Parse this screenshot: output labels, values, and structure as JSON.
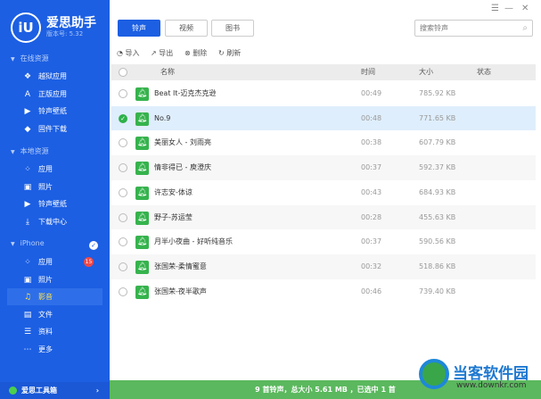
{
  "app": {
    "name": "爱思助手",
    "version": "版本号: 5.32",
    "logo_text": "iU"
  },
  "sidebar": {
    "sections": [
      {
        "label": "在线资源",
        "items": [
          {
            "label": "越狱应用",
            "icon": "jailbreak-icon"
          },
          {
            "label": "正版应用",
            "icon": "appstore-icon"
          },
          {
            "label": "铃声壁纸",
            "icon": "film-icon"
          },
          {
            "label": "固件下载",
            "icon": "box-icon"
          }
        ]
      },
      {
        "label": "本地资源",
        "items": [
          {
            "label": "应用",
            "icon": "apps-icon"
          },
          {
            "label": "照片",
            "icon": "photo-icon"
          },
          {
            "label": "铃声壁纸",
            "icon": "film-icon"
          },
          {
            "label": "下载中心",
            "icon": "download-icon"
          }
        ]
      },
      {
        "label": "iPhone",
        "items": [
          {
            "label": "应用",
            "icon": "apps-icon",
            "badge": "15"
          },
          {
            "label": "照片",
            "icon": "photo-icon"
          },
          {
            "label": "影音",
            "icon": "media-icon",
            "active": true
          },
          {
            "label": "文件",
            "icon": "file-icon"
          },
          {
            "label": "资料",
            "icon": "list-icon"
          },
          {
            "label": "更多",
            "icon": "more-icon"
          }
        ]
      }
    ],
    "toolbox": "爱思工具箱"
  },
  "tabs": [
    "铃声",
    "视频",
    "图书"
  ],
  "search": {
    "placeholder": "搜索铃声"
  },
  "toolbar": {
    "import": "导入",
    "export": "导出",
    "delete": "删除",
    "refresh": "刷新"
  },
  "table": {
    "headers": {
      "name": "名称",
      "time": "时间",
      "size": "大小",
      "status": "状态"
    },
    "rows": [
      {
        "name": "Beat It-迈克杰克逊",
        "time": "00:49",
        "size": "785.92 KB",
        "checked": false
      },
      {
        "name": "No.9",
        "time": "00:48",
        "size": "771.65 KB",
        "checked": true
      },
      {
        "name": "美丽女人 - 刘雨亮",
        "time": "00:38",
        "size": "607.79 KB",
        "checked": false
      },
      {
        "name": "情非得已 - 庾澄庆",
        "time": "00:37",
        "size": "592.37 KB",
        "checked": false
      },
      {
        "name": "许志安-体谅",
        "time": "00:43",
        "size": "684.93 KB",
        "checked": false
      },
      {
        "name": "野子-苏运莹",
        "time": "00:28",
        "size": "455.63 KB",
        "checked": false
      },
      {
        "name": "月半小夜曲 - 好听纯音乐",
        "time": "00:37",
        "size": "590.56 KB",
        "checked": false
      },
      {
        "name": "张国荣-柔情蜜意",
        "time": "00:32",
        "size": "518.86 KB",
        "checked": false
      },
      {
        "name": "张国荣-夜半歌声",
        "time": "00:46",
        "size": "739.40 KB",
        "checked": false
      }
    ]
  },
  "status_bar": "9 首铃声，总大小 5.61 MB ，已选中 1 首",
  "watermark": {
    "title": "当客软件园",
    "url": "www.downkr.com"
  }
}
